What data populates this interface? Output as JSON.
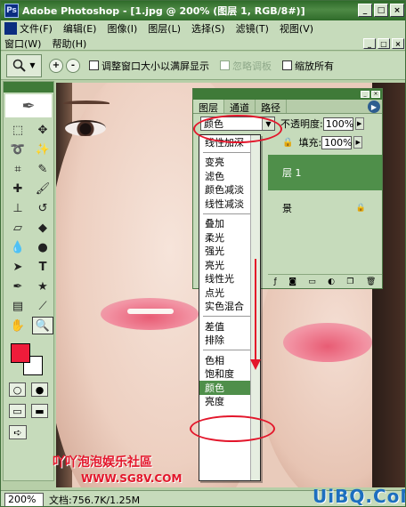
{
  "window": {
    "app_icon": "Ps",
    "title": "Adobe Photoshop - [1.jpg @ 200% (图层 1, RGB/8#)]",
    "buttons": [
      "_",
      "□",
      "×"
    ]
  },
  "menu_row1": [
    "文件(F)",
    "编辑(E)",
    "图像(I)",
    "图层(L)",
    "选择(S)",
    "滤镜(T)",
    "视图(V)"
  ],
  "menu_row2": [
    "窗口(W)",
    "帮助(H)"
  ],
  "doc_buttons": [
    "_",
    "□",
    "×"
  ],
  "options": {
    "zoom_in": "+",
    "zoom_out": "-",
    "resize_label": "调整窗口大小以满屏显示",
    "ignore_palettes_label": "忽略调板",
    "zoom_all_label": "缩放所有"
  },
  "toolbox": {
    "icons": [
      "marquee-icon",
      "move-icon",
      "lasso-icon",
      "magic-wand-icon",
      "crop-icon",
      "slice-icon",
      "healing-brush-icon",
      "brush-icon",
      "clone-stamp-icon",
      "history-brush-icon",
      "eraser-icon",
      "paint-bucket-icon",
      "blur-icon",
      "dodge-icon",
      "path-select-icon",
      "type-icon",
      "pen-icon",
      "shape-icon",
      "notes-icon",
      "eyedropper-icon",
      "hand-icon",
      "zoom-icon"
    ],
    "foreground_color": "#ee1c3a",
    "background_color": "#ffffff"
  },
  "layers_panel": {
    "tabs": [
      "图层",
      "通道",
      "路径"
    ],
    "blend_mode": "颜色",
    "opacity_label": "不透明度:",
    "opacity_value": "100%",
    "fill_label": "填充:",
    "fill_value": "100%",
    "layer_name": "层 1",
    "background_name": "景"
  },
  "blend_list": {
    "group1": [
      "线性加深"
    ],
    "group2": [
      "变亮",
      "滤色",
      "颜色减淡",
      "线性减淡"
    ],
    "group3": [
      "叠加",
      "柔光",
      "强光",
      "亮光",
      "线性光",
      "点光",
      "实色混合"
    ],
    "group4": [
      "差值",
      "排除"
    ],
    "group5": [
      "色相",
      "饱和度",
      "颜色",
      "亮度"
    ]
  },
  "watermarks": {
    "forum": "吖吖泡泡娱乐社區",
    "url": "WWW.SG8V.COM",
    "brand": "UiBQ.CoM"
  },
  "status": {
    "zoom": "200%",
    "doc": "文档:756.7K/1.25M"
  },
  "colors": {
    "annotation": "#e3162b",
    "selection": "#4f8f4a"
  }
}
